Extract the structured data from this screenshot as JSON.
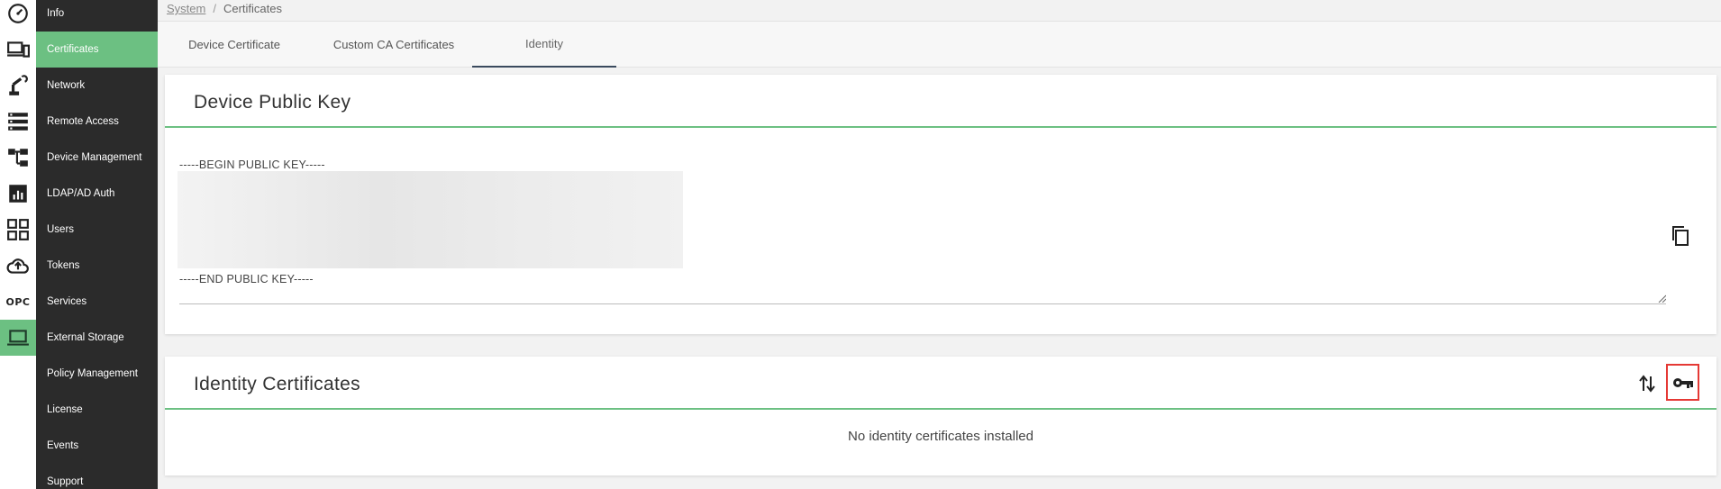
{
  "rail": {
    "icons": [
      "dashboard-icon",
      "devices-icon",
      "robot-arm-icon",
      "server-list-icon",
      "tree-icon",
      "bar-chart-icon",
      "apps-grid-icon",
      "cloud-upload-icon",
      "opc-icon",
      "laptop-icon"
    ],
    "opc_label": "OPC",
    "active_color": "#6cc082"
  },
  "nav": {
    "items": [
      {
        "label": "Info"
      },
      {
        "label": "Certificates"
      },
      {
        "label": "Network"
      },
      {
        "label": "Remote Access"
      },
      {
        "label": "Device Management"
      },
      {
        "label": "LDAP/AD Auth"
      },
      {
        "label": "Users"
      },
      {
        "label": "Tokens"
      },
      {
        "label": "Services"
      },
      {
        "label": "External Storage"
      },
      {
        "label": "Policy Management"
      },
      {
        "label": "License"
      },
      {
        "label": "Events"
      },
      {
        "label": "Support"
      }
    ],
    "active": "Certificates"
  },
  "breadcrumb": {
    "parent": "System",
    "separator": "/",
    "current": "Certificates"
  },
  "tabs": [
    {
      "label": "Device Certificate"
    },
    {
      "label": "Custom CA Certificates"
    },
    {
      "label": "Identity"
    }
  ],
  "active_tab": "Identity",
  "public_key_card": {
    "title": "Device Public Key",
    "begin_line": "-----BEGIN PUBLIC KEY-----",
    "end_line": "-----END PUBLIC KEY-----",
    "copy_icon": "copy-icon"
  },
  "identity_card": {
    "title": "Identity Certificates",
    "empty_message": "No identity certificates installed",
    "sort_icon": "sort-arrows-icon",
    "key_icon": "key-icon"
  }
}
